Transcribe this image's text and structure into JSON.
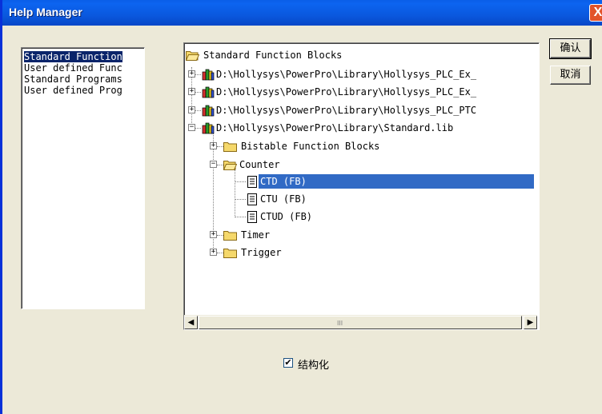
{
  "window": {
    "title": "Help Manager",
    "close_glyph": "X"
  },
  "left_list": {
    "items": [
      {
        "label": "Standard Function",
        "selected": true
      },
      {
        "label": "User defined Func",
        "selected": false
      },
      {
        "label": "Standard Programs",
        "selected": false
      },
      {
        "label": "User defined Prog",
        "selected": false
      }
    ]
  },
  "tree": {
    "root": "Standard Function Blocks",
    "libraries": [
      "D:\\Hollysys\\PowerPro\\Library\\Hollysys_PLC_Ex_",
      "D:\\Hollysys\\PowerPro\\Library\\Hollysys_PLC_Ex_",
      "D:\\Hollysys\\PowerPro\\Library\\Hollysys_PLC_PTC",
      "D:\\Hollysys\\PowerPro\\Library\\Standard.lib"
    ],
    "folders": {
      "bistable": "Bistable Function Blocks",
      "counter": "Counter",
      "timer": "Timer",
      "trigger": "Trigger"
    },
    "counter_items": [
      "CTD (FB)",
      "CTU (FB)",
      "CTUD (FB)"
    ],
    "selected_item": "CTD (FB)",
    "expander_plus": "+",
    "expander_minus": "−"
  },
  "scrollbar": {
    "left_arrow": "◀",
    "right_arrow": "▶",
    "grip": "III"
  },
  "buttons": {
    "ok": "确认",
    "cancel": "取消"
  },
  "structured": {
    "label": "结构化",
    "checked": true,
    "check_glyph": "✔"
  },
  "colors": {
    "title_bar": "#0a5ee8",
    "selection": "#316ac5",
    "list_selection": "#0a246a",
    "dialog_bg": "#ece9d8"
  }
}
